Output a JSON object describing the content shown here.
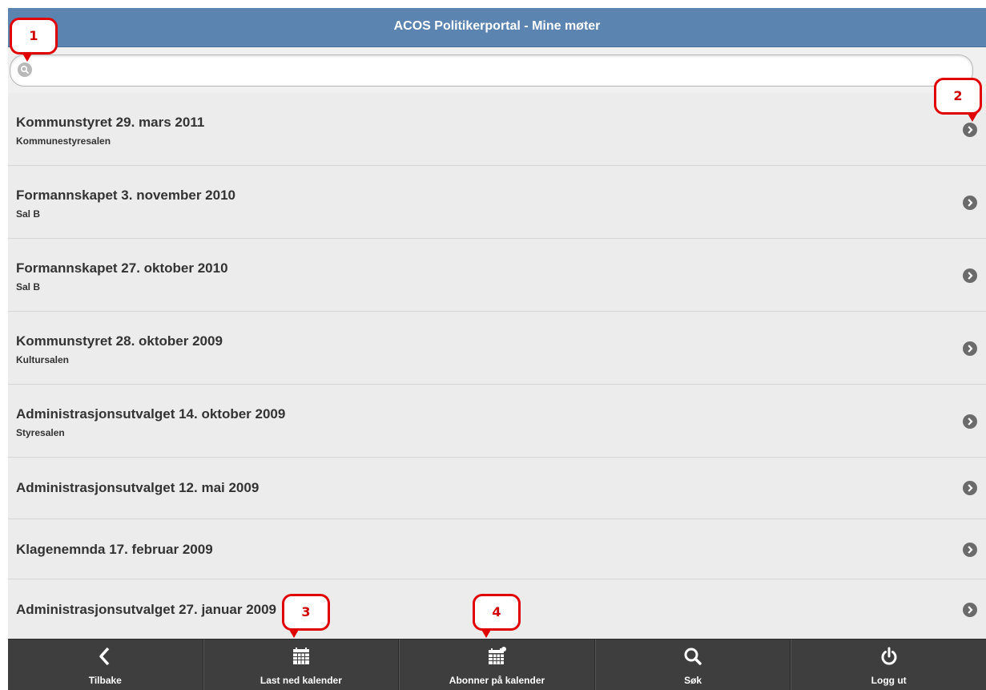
{
  "header": {
    "title": "ACOS Politikerportal - Mine møter"
  },
  "search": {
    "value": "",
    "placeholder": ""
  },
  "meetings": [
    {
      "title": "Kommunstyret 29. mars 2011",
      "location": "Kommunestyresalen"
    },
    {
      "title": "Formannskapet 3. november 2010",
      "location": "Sal B"
    },
    {
      "title": "Formannskapet 27. oktober 2010",
      "location": "Sal B"
    },
    {
      "title": "Kommunstyret 28. oktober 2009",
      "location": "Kultursalen"
    },
    {
      "title": "Administrasjonsutvalget 14. oktober 2009",
      "location": "Styresalen"
    },
    {
      "title": "Administrasjonsutvalget 12. mai 2009",
      "location": ""
    },
    {
      "title": "Klagenemnda 17. februar 2009",
      "location": ""
    },
    {
      "title": "Administrasjonsutvalget 27. januar 2009",
      "location": ""
    }
  ],
  "toolbar": {
    "back": "Tilbake",
    "download_calendar": "Last ned kalender",
    "subscribe_calendar": "Abonner på kalender",
    "search": "Søk",
    "logout": "Logg ut"
  },
  "callouts": [
    "1",
    "2",
    "3",
    "4"
  ],
  "colors": {
    "header": "#5b84b1",
    "toolbar": "#3e3e3e",
    "callout": "#e00000"
  }
}
